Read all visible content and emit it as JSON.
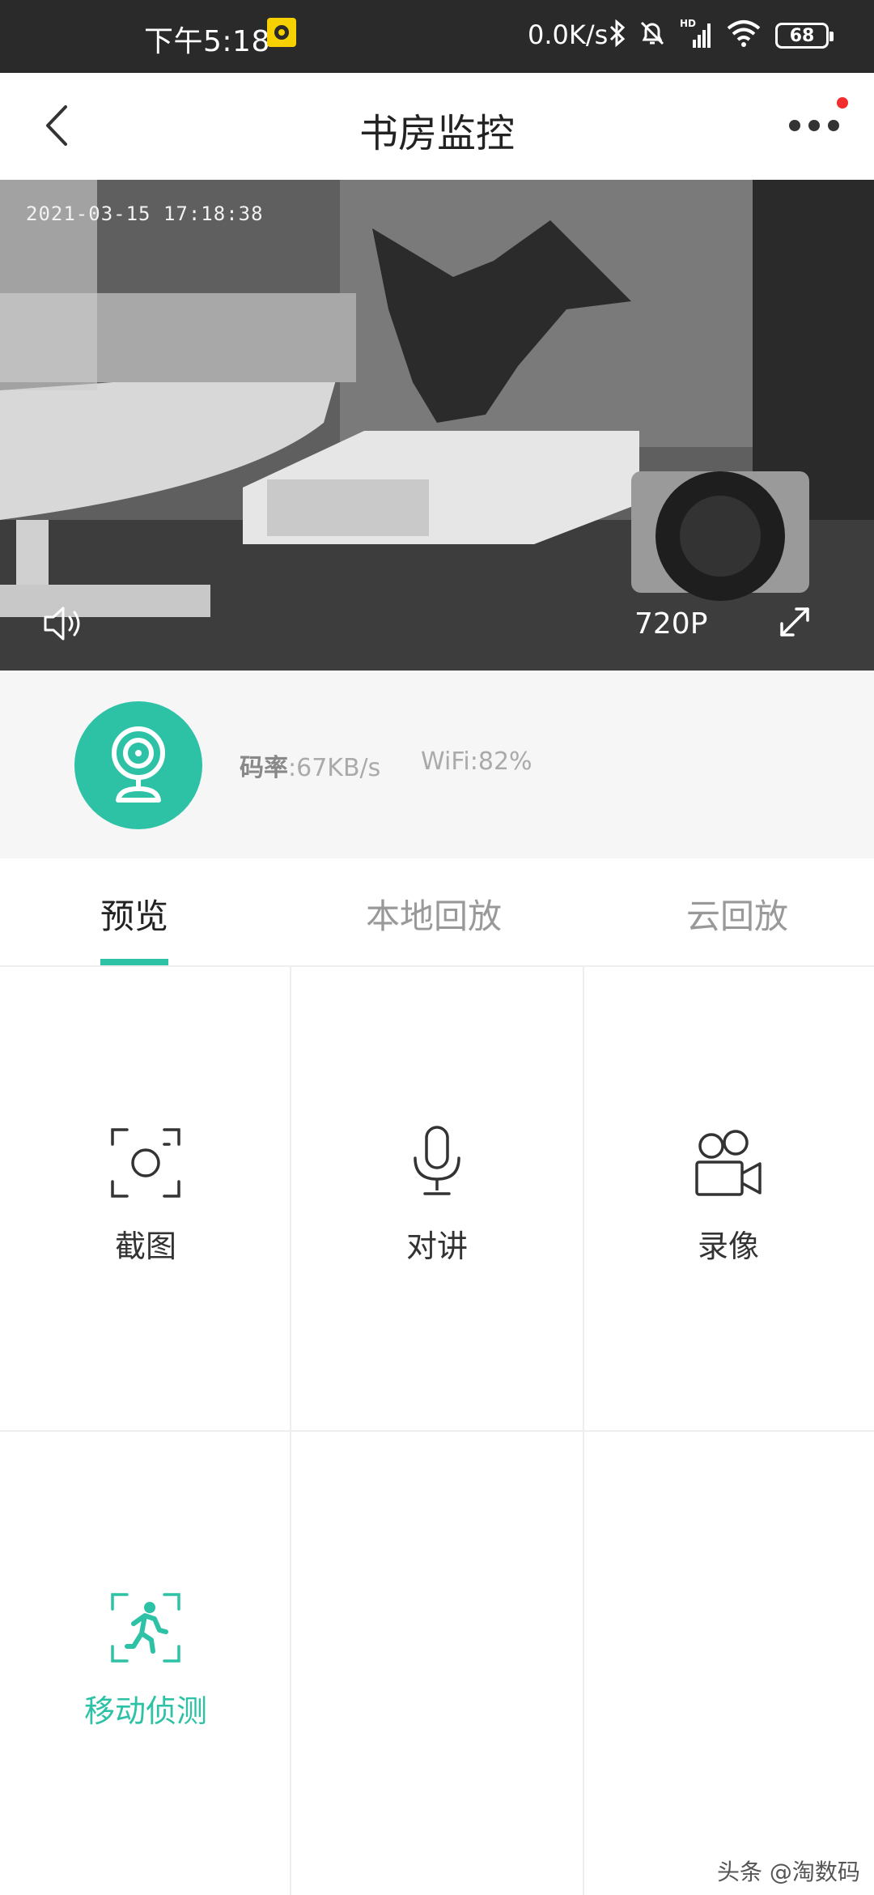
{
  "status_bar": {
    "time": "下午5:18",
    "network_speed": "0.0K/s",
    "battery": "68",
    "icons": [
      "notification-icon",
      "bluetooth-icon",
      "alarm-off-icon",
      "signal-hd-icon",
      "wifi-icon",
      "battery-icon"
    ]
  },
  "header": {
    "title": "书房监控",
    "has_notification_dot": true
  },
  "video": {
    "timestamp": "2021-03-15 17:18:38",
    "resolution": "720P"
  },
  "info": {
    "bitrate_label": "码率",
    "bitrate_value": ":67KB/s",
    "wifi_label": "WiFi",
    "wifi_value": ":82%"
  },
  "tabs": [
    {
      "label": "预览",
      "active": true
    },
    {
      "label": "本地回放",
      "active": false
    },
    {
      "label": "云回放",
      "active": false
    }
  ],
  "actions": [
    {
      "label": "截图",
      "icon": "screenshot-icon"
    },
    {
      "label": "对讲",
      "icon": "microphone-icon"
    },
    {
      "label": "录像",
      "icon": "video-record-icon"
    },
    {
      "label": "移动侦测",
      "icon": "motion-detect-icon",
      "highlighted": true
    }
  ],
  "watermark": "头条 @淘数码",
  "colors": {
    "accent": "#2dc2a6",
    "status_bar": "#2a2a2a",
    "notification_dot": "#f12d2d"
  }
}
